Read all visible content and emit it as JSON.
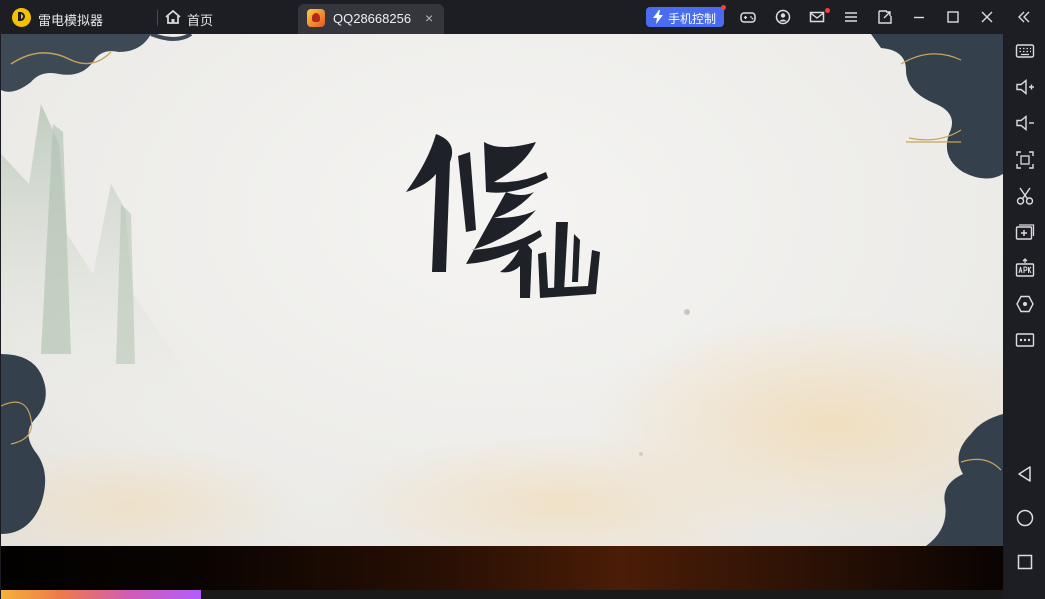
{
  "titlebar": {
    "app_name": "雷电模拟器",
    "home_tab_label": "首页",
    "game_tab_label": "QQ28668256",
    "game_tab_close": "×",
    "phone_control_label": "手机控制",
    "icons": [
      "gamepad-icon",
      "account-icon",
      "mail-icon",
      "menu-icon",
      "screenshot-icon",
      "minimize-icon",
      "maximize-icon",
      "close-icon",
      "collapse-sidebar-icon"
    ],
    "accent": "#4a6cf0",
    "logo_color": "#f4c200"
  },
  "sidebar": {
    "icons": [
      "keyboard-mapping-icon",
      "volume-up-icon",
      "volume-down-icon",
      "fullscreen-icon",
      "scissors-icon",
      "add-window-icon",
      "install-apk-icon",
      "settings-hex-icon",
      "more-icon",
      "back-icon",
      "home-icon",
      "recent-apps-icon"
    ]
  },
  "game": {
    "title_glyphs": "修仙",
    "loading_progress": 0.2
  }
}
